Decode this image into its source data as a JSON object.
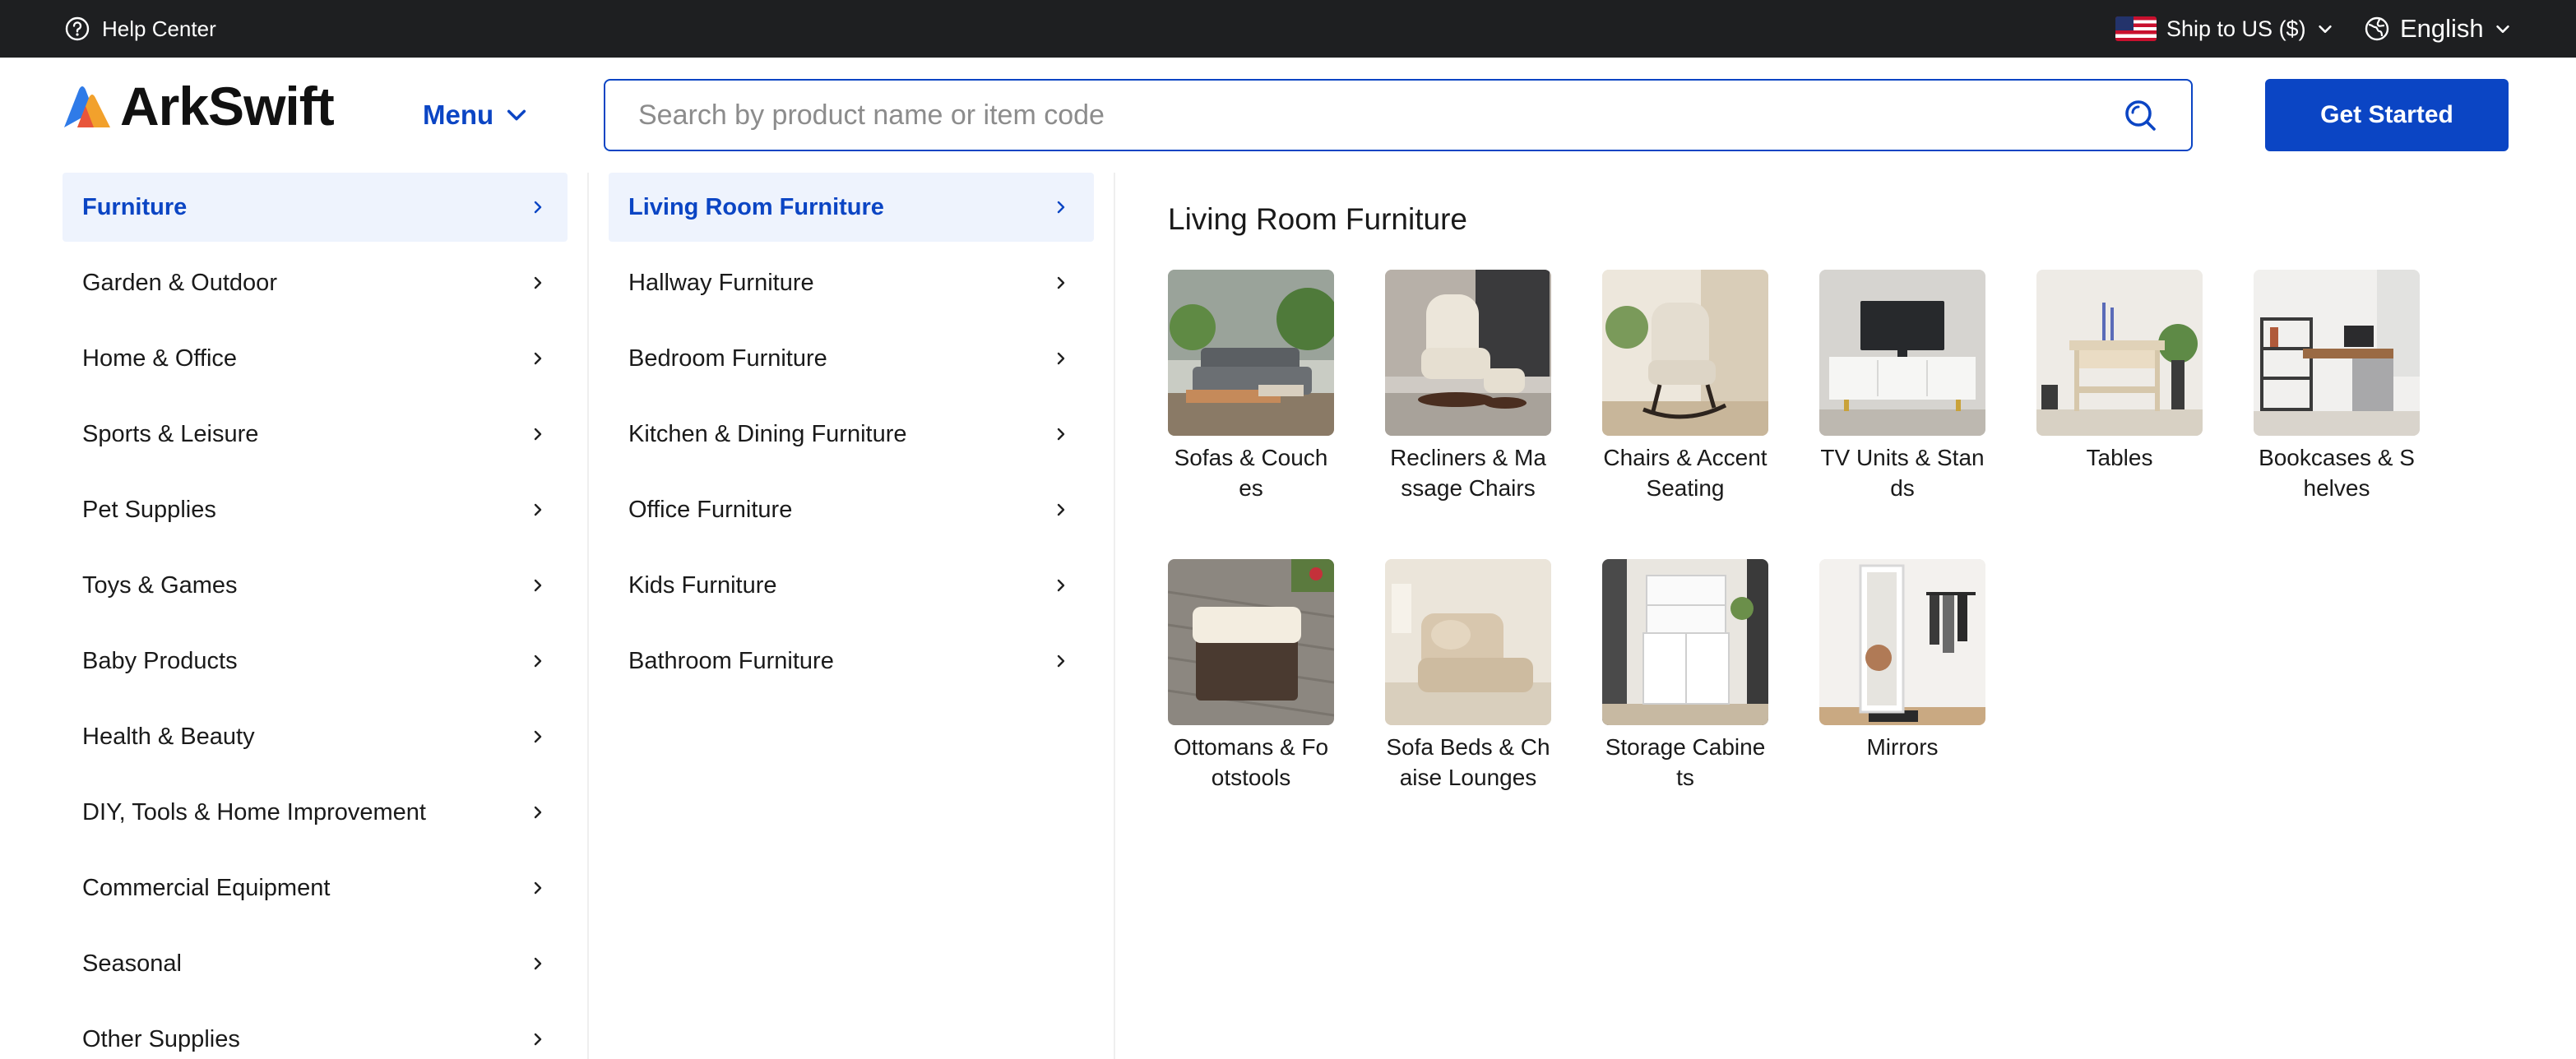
{
  "topbar": {
    "help_label": "Help Center",
    "ship_label": "Ship to US ($)",
    "language_label": "English"
  },
  "header": {
    "logo_text": "ArkSwift",
    "menu_label": "Menu",
    "search_placeholder": "Search by product name or item code",
    "cta_label": "Get Started"
  },
  "categories": [
    {
      "label": "Furniture"
    },
    {
      "label": "Garden & Outdoor"
    },
    {
      "label": "Home & Office"
    },
    {
      "label": "Sports & Leisure"
    },
    {
      "label": "Pet Supplies"
    },
    {
      "label": "Toys & Games"
    },
    {
      "label": "Baby Products"
    },
    {
      "label": "Health & Beauty"
    },
    {
      "label": "DIY, Tools & Home Improvement"
    },
    {
      "label": "Commercial Equipment"
    },
    {
      "label": "Seasonal"
    },
    {
      "label": "Other Supplies"
    }
  ],
  "subcategories": [
    {
      "label": "Living Room Furniture"
    },
    {
      "label": "Hallway Furniture"
    },
    {
      "label": "Bedroom Furniture"
    },
    {
      "label": "Kitchen & Dining Furniture"
    },
    {
      "label": "Office Furniture"
    },
    {
      "label": "Kids Furniture"
    },
    {
      "label": "Bathroom Furniture"
    }
  ],
  "panel": {
    "title": "Living Room Furniture",
    "tiles": [
      {
        "label": "Sofas & Couches",
        "icon": "sofa-icon"
      },
      {
        "label": "Recliners & Massage Chairs",
        "icon": "recliner-icon"
      },
      {
        "label": "Chairs & Accent Seating",
        "icon": "rocking-chair-icon"
      },
      {
        "label": "TV Units & Stands",
        "icon": "tv-stand-icon"
      },
      {
        "label": "Tables",
        "icon": "console-table-icon"
      },
      {
        "label": "Bookcases & Shelves",
        "icon": "bookcase-icon"
      },
      {
        "label": "Ottomans & Footstools",
        "icon": "ottoman-icon"
      },
      {
        "label": "Sofa Beds & Chaise Lounges",
        "icon": "sofa-bed-icon"
      },
      {
        "label": "Storage Cabinets",
        "icon": "cabinet-icon"
      },
      {
        "label": "Mirrors",
        "icon": "mirror-icon"
      }
    ]
  },
  "colors": {
    "brand_blue": "#0b45c4",
    "topbar_bg": "#1e1f21",
    "active_bg": "#eef3fd"
  }
}
